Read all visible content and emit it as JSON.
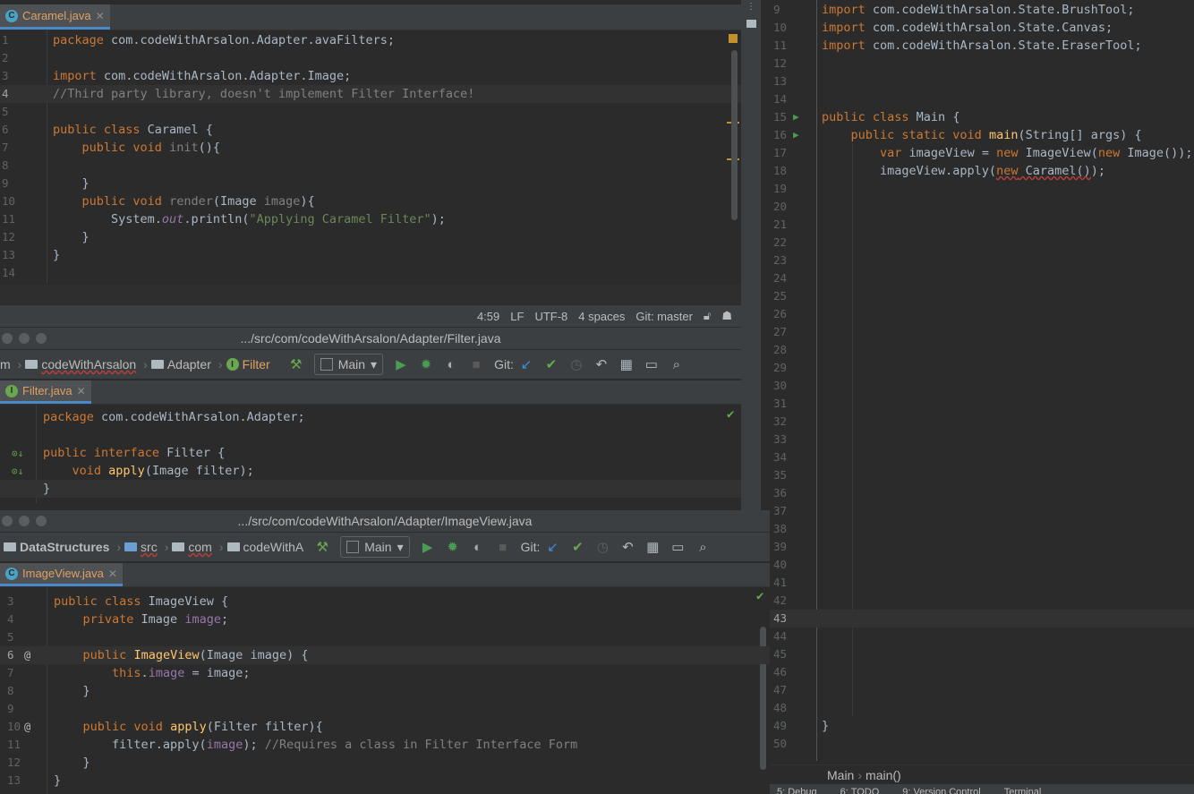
{
  "caramel_window": {
    "tab_label": "Caramel.java",
    "tab_icon": "C",
    "lines": [
      {
        "n": "1",
        "html": "<span class='kw'>package</span> com.codeWithArsalon.Adapter.avaFilters;"
      },
      {
        "n": "2",
        "html": ""
      },
      {
        "n": "3",
        "html": "<span class='kw'>import</span> com.codeWithArsalon.Adapter.Image;"
      },
      {
        "n": "4",
        "html": "<span class='cm'>//Third party library, doesn't implement Filter Interface!</span>",
        "hl": true
      },
      {
        "n": "5",
        "html": ""
      },
      {
        "n": "6",
        "html": "<span class='kw'>public class</span> Caramel {"
      },
      {
        "n": "7",
        "html": "    <span class='kw'>public void</span> <span class='gray'>init</span>(){"
      },
      {
        "n": "8",
        "html": ""
      },
      {
        "n": "9",
        "html": "    }"
      },
      {
        "n": "10",
        "html": "    <span class='kw'>public void</span> <span class='gray'>render</span>(Image <span class='gray'>image</span>){"
      },
      {
        "n": "11",
        "html": "        System.<span class='it'>out</span>.println(<span class='str'>\"Applying Caramel Filter\"</span>);"
      },
      {
        "n": "12",
        "html": "    }"
      },
      {
        "n": "13",
        "html": "}"
      },
      {
        "n": "14",
        "html": ""
      }
    ],
    "status": {
      "position": "4:59",
      "line_sep": "LF",
      "encoding": "UTF-8",
      "indent": "4 spaces",
      "vcs": "Git: master"
    }
  },
  "filter_window": {
    "title": ".../src/com/codeWithArsalon/Adapter/Filter.java",
    "breadcrumbs": [
      "m",
      "codeWithArsalon",
      "Adapter",
      "Filter"
    ],
    "run_config": "Main",
    "git_label": "Git:",
    "tab_label": "Filter.java",
    "tab_icon": "I",
    "lines": [
      {
        "n": "",
        "html": "<span class='kw'>package</span> com.codeWithArsalon.Adapter;"
      },
      {
        "n": "",
        "html": ""
      },
      {
        "n": "",
        "html": "<span class='kw'>public interface</span> Filter {"
      },
      {
        "n": "",
        "html": "    <span class='kw'>void</span> <span class='fn'>apply</span>(Image filter);"
      },
      {
        "n": "",
        "html": "}",
        "hl": true
      }
    ]
  },
  "imageview_window": {
    "title": ".../src/com/codeWithArsalon/Adapter/ImageView.java",
    "breadcrumbs": [
      "DataStructures",
      "src",
      "com",
      "codeWithA"
    ],
    "run_config": "Main",
    "git_label": "Git:",
    "tab_label": "ImageView.java",
    "tab_icon": "C",
    "lines": [
      {
        "n": "3",
        "html": "<span class='kw'>public class</span> ImageView {"
      },
      {
        "n": "4",
        "html": "    <span class='kw'>private</span> Image <span class='fld'>image</span>;"
      },
      {
        "n": "5",
        "html": ""
      },
      {
        "n": "6",
        "html": "    <span class='kw'>public</span> <span class='fn'>ImageView</span>(Image image) {",
        "hl": true,
        "at": true
      },
      {
        "n": "7",
        "html": "        <span class='kw'>this</span>.<span class='fld'>image</span> = image;"
      },
      {
        "n": "8",
        "html": "    }"
      },
      {
        "n": "9",
        "html": ""
      },
      {
        "n": "10",
        "html": "    <span class='kw'>public void</span> <span class='fn'>apply</span>(Filter filter){",
        "at": true
      },
      {
        "n": "11",
        "html": "        filter.apply(<span class='fld'>image</span>); <span class='cm'>//Requires a class in Filter Interface Form</span>"
      },
      {
        "n": "12",
        "html": "    }"
      },
      {
        "n": "13",
        "html": "}"
      }
    ]
  },
  "main_window": {
    "lines": [
      {
        "n": "9",
        "html": "<span class='kw'>import</span> com.codeWithArsalon.State.BrushTool;"
      },
      {
        "n": "10",
        "html": "<span class='kw'>import</span> com.codeWithArsalon.State.Canvas;"
      },
      {
        "n": "11",
        "html": "<span class='kw'>import</span> com.codeWithArsalon.State.EraserTool;"
      },
      {
        "n": "12",
        "html": ""
      },
      {
        "n": "13",
        "html": ""
      },
      {
        "n": "14",
        "html": ""
      },
      {
        "n": "15",
        "html": "<span class='kw'>public class</span> Main {",
        "run": true
      },
      {
        "n": "16",
        "html": "    <span class='kw'>public static void</span> <span class='fn'>main</span>(String[] args) {",
        "run": true
      },
      {
        "n": "17",
        "html": "        <span class='kw'>var</span> imageView = <span class='kw'>new</span> ImageView(<span class='kw'>new</span> Image());"
      },
      {
        "n": "18",
        "html": "        imageView.apply(<span class='wavy'><span class='kw'>new</span> Caramel()</span>);"
      },
      {
        "n": "19",
        "html": ""
      },
      {
        "n": "20",
        "html": ""
      },
      {
        "n": "21",
        "html": ""
      },
      {
        "n": "22",
        "html": ""
      },
      {
        "n": "23",
        "html": ""
      },
      {
        "n": "24",
        "html": ""
      },
      {
        "n": "25",
        "html": ""
      },
      {
        "n": "26",
        "html": ""
      },
      {
        "n": "27",
        "html": ""
      },
      {
        "n": "28",
        "html": ""
      },
      {
        "n": "29",
        "html": ""
      },
      {
        "n": "30",
        "html": ""
      },
      {
        "n": "31",
        "html": ""
      },
      {
        "n": "32",
        "html": ""
      },
      {
        "n": "33",
        "html": ""
      },
      {
        "n": "34",
        "html": ""
      },
      {
        "n": "35",
        "html": ""
      },
      {
        "n": "36",
        "html": ""
      },
      {
        "n": "37",
        "html": ""
      },
      {
        "n": "38",
        "html": ""
      },
      {
        "n": "39",
        "html": ""
      },
      {
        "n": "40",
        "html": ""
      },
      {
        "n": "41",
        "html": ""
      },
      {
        "n": "42",
        "html": ""
      },
      {
        "n": "43",
        "html": "",
        "hl": true
      },
      {
        "n": "44",
        "html": ""
      },
      {
        "n": "45",
        "html": ""
      },
      {
        "n": "46",
        "html": ""
      },
      {
        "n": "47",
        "html": ""
      },
      {
        "n": "48",
        "html": ""
      },
      {
        "n": "49",
        "html": "}"
      },
      {
        "n": "50",
        "html": ""
      }
    ],
    "breadcrumb": [
      "Main",
      "main()"
    ],
    "bottom_tools": [
      "5: Debug",
      "6: TODO",
      "9: Version Control",
      "Terminal"
    ]
  }
}
